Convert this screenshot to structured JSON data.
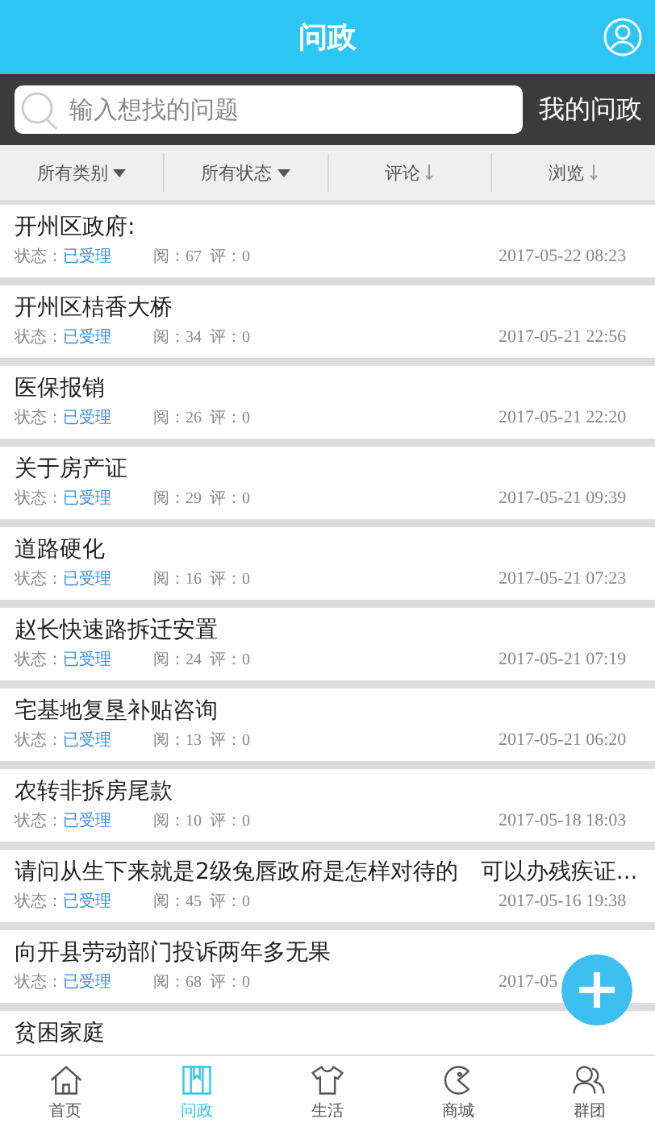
{
  "header": {
    "title": "问政"
  },
  "search": {
    "placeholder": "输入想找的问题",
    "my_link": "我的问政"
  },
  "filters": [
    {
      "label": "所有类别",
      "kind": "dropdown"
    },
    {
      "label": "所有状态",
      "kind": "dropdown"
    },
    {
      "label": "评论",
      "kind": "sort"
    },
    {
      "label": "浏览",
      "kind": "sort"
    }
  ],
  "items": [
    {
      "title": "开州区政府:",
      "status_label": "状态：",
      "status": "已受理",
      "views": "阅：67",
      "comments": "评：0",
      "date": "2017-05-22 08:23"
    },
    {
      "title": "开州区桔香大桥",
      "status_label": "状态：",
      "status": "已受理",
      "views": "阅：34",
      "comments": "评：0",
      "date": "2017-05-21 22:56"
    },
    {
      "title": "医保报销",
      "status_label": "状态：",
      "status": "已受理",
      "views": "阅：26",
      "comments": "评：0",
      "date": "2017-05-21 22:20"
    },
    {
      "title": "关于房产证",
      "status_label": "状态：",
      "status": "已受理",
      "views": "阅：29",
      "comments": "评：0",
      "date": "2017-05-21 09:39"
    },
    {
      "title": "道路硬化",
      "status_label": "状态：",
      "status": "已受理",
      "views": "阅：16",
      "comments": "评：0",
      "date": "2017-05-21 07:23"
    },
    {
      "title": "赵长快速路拆迁安置",
      "status_label": "状态：",
      "status": "已受理",
      "views": "阅：24",
      "comments": "评：0",
      "date": "2017-05-21 07:19"
    },
    {
      "title": "宅基地复垦补贴咨询",
      "status_label": "状态：",
      "status": "已受理",
      "views": "阅：13",
      "comments": "评：0",
      "date": "2017-05-21 06:20"
    },
    {
      "title": "农转非拆房尾款",
      "status_label": "状态：",
      "status": "已受理",
      "views": "阅：10",
      "comments": "评：0",
      "date": "2017-05-18 18:03"
    },
    {
      "title": "请问从生下来就是2级兔唇政府是怎样对待的　可以办残疾证...",
      "status_label": "状态：",
      "status": "已受理",
      "views": "阅：45",
      "comments": "评：0",
      "date": "2017-05-16 19:38"
    },
    {
      "title": "向开县劳动部门投诉两年多无果",
      "status_label": "状态：",
      "status": "已受理",
      "views": "阅：68",
      "comments": "评：0",
      "date": "2017-05"
    },
    {
      "title": "贫困家庭"
    }
  ],
  "tabs": [
    {
      "label": "首页",
      "selected": false
    },
    {
      "label": "问政",
      "selected": true
    },
    {
      "label": "生活",
      "selected": false
    },
    {
      "label": "商城",
      "selected": false
    },
    {
      "label": "群团",
      "selected": false
    }
  ]
}
